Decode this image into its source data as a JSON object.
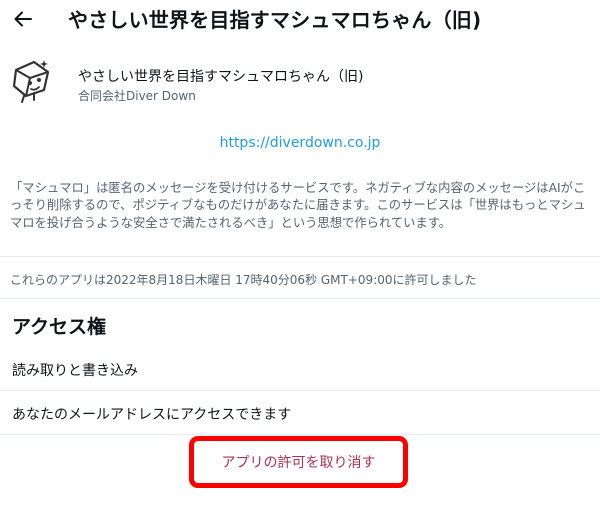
{
  "header": {
    "title": "やさしい世界を目指すマシュマロちゃん（旧)"
  },
  "app": {
    "name": "やさしい世界を目指すマシュマロちゃん（旧)",
    "organization": "合同会社Diver Down",
    "link": "https://diverdown.co.jp",
    "description": "「マシュマロ」は匿名のメッセージを受け付けるサービスです。ネガティブな内容のメッセージはAIがこっそり削除するので、ポジティブなものだけがあなたに届きます。このサービスは「世界はもっとマシュマロを投げ合うような安全さで満たされるべき」という思想で作られています。"
  },
  "permission": {
    "granted_at": "これらのアプリは2022年8月18日木曜日 17時40分06秒 GMT+09:00に許可しました"
  },
  "access": {
    "heading": "アクセス権",
    "items": [
      "読み取りと書き込み",
      "あなたのメールアドレスにアクセスできます"
    ]
  },
  "actions": {
    "revoke_label": "アプリの許可を取り消す"
  },
  "colors": {
    "link": "#1d9bf0",
    "revoke_text": "#b0314b",
    "highlight": "#ff0000",
    "muted": "#536471"
  },
  "icons": {
    "back": "arrow-left-icon",
    "logo": "marshmallow-logo-icon"
  }
}
